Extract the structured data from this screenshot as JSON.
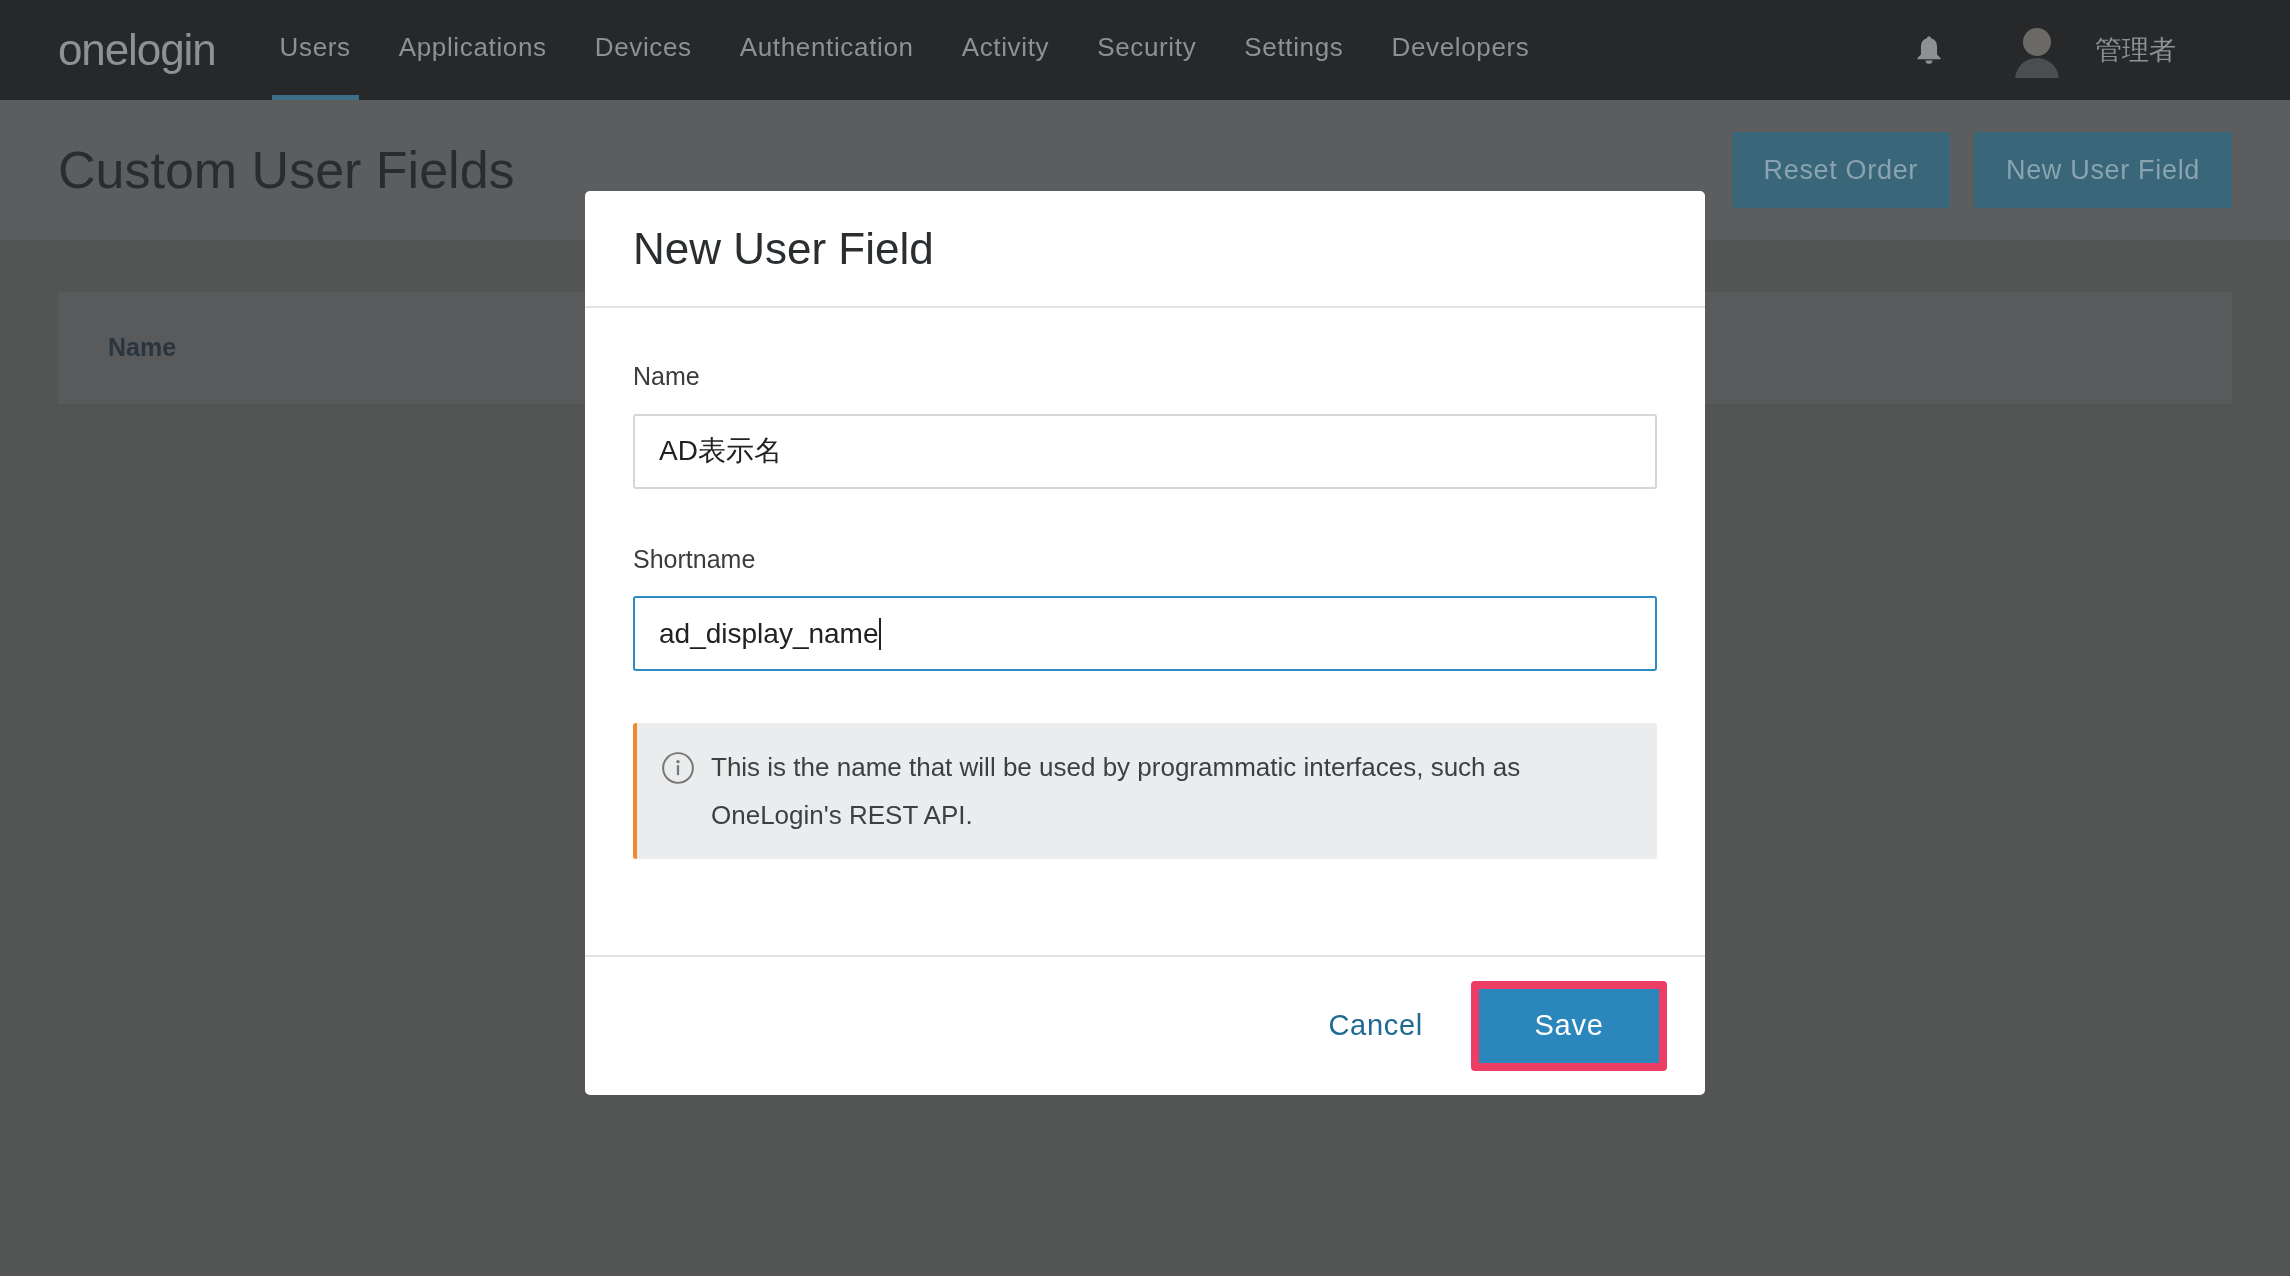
{
  "topbar": {
    "logo": "onelogin",
    "nav": [
      {
        "label": "Users",
        "selected": true
      },
      {
        "label": "Applications",
        "selected": false
      },
      {
        "label": "Devices",
        "selected": false
      },
      {
        "label": "Authentication",
        "selected": false
      },
      {
        "label": "Activity",
        "selected": false
      },
      {
        "label": "Security",
        "selected": false
      },
      {
        "label": "Settings",
        "selected": false
      },
      {
        "label": "Developers",
        "selected": false
      }
    ],
    "user_name": "管理者"
  },
  "page": {
    "title": "Custom User Fields",
    "buttons": [
      "Reset Order",
      "New User Field"
    ],
    "table": {
      "columns": [
        "Name"
      ]
    }
  },
  "dialog": {
    "title": "New User Field",
    "fields": [
      {
        "label": "Name",
        "value": "AD表示名",
        "focused": false
      },
      {
        "label": "Shortname",
        "value": "ad_display_name",
        "focused": true
      }
    ],
    "note": "This is the name that will be used by programmatic interfaces, such as OneLogin's REST API.",
    "cancel": "Cancel",
    "save": {
      "label": "Save",
      "highlighted": true
    }
  }
}
